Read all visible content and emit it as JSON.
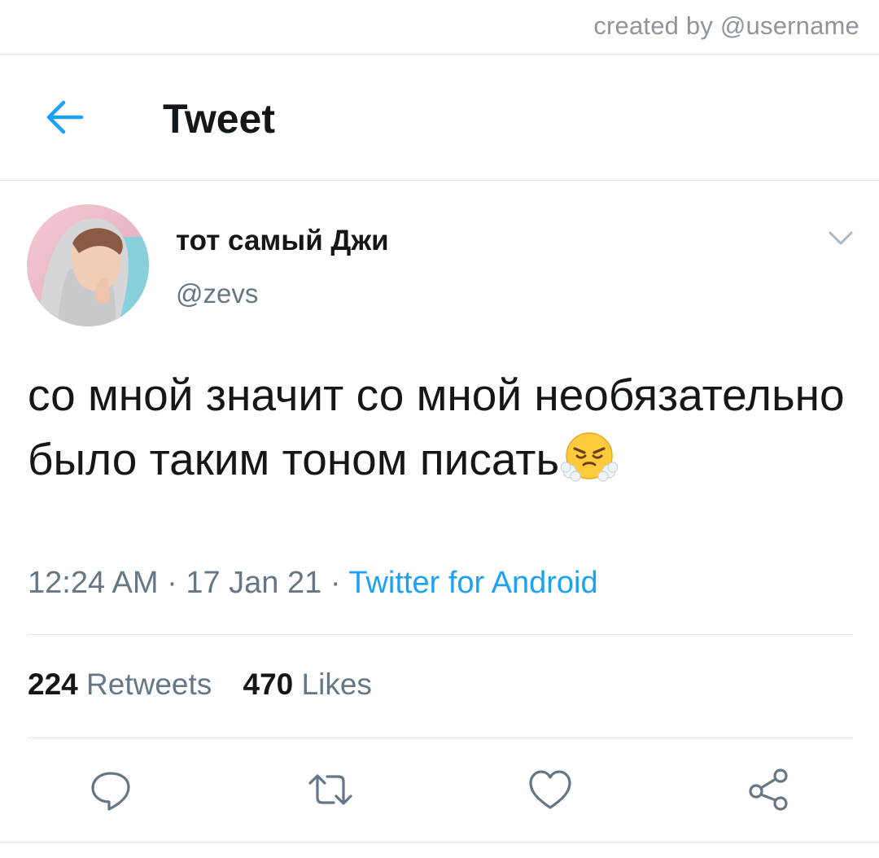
{
  "watermark": "created by @username",
  "header": {
    "title": "Tweet",
    "back_icon": "arrow-left-icon",
    "accent_color": "#1da1f2"
  },
  "tweet": {
    "display_name": "тот самый Джи",
    "handle": "@zevs",
    "text": "со мной значит со мной необязательно было таким тоном писать",
    "emoji": "face-with-steam-from-nose",
    "time": "12:24 AM",
    "separator": " · ",
    "date": "17 Jan 21",
    "source": "Twitter for Android"
  },
  "stats": {
    "retweets_count": "224",
    "retweets_label": "Retweets",
    "likes_count": "470",
    "likes_label": "Likes"
  },
  "actions": [
    "reply-icon",
    "retweet-icon",
    "like-icon",
    "share-icon"
  ]
}
